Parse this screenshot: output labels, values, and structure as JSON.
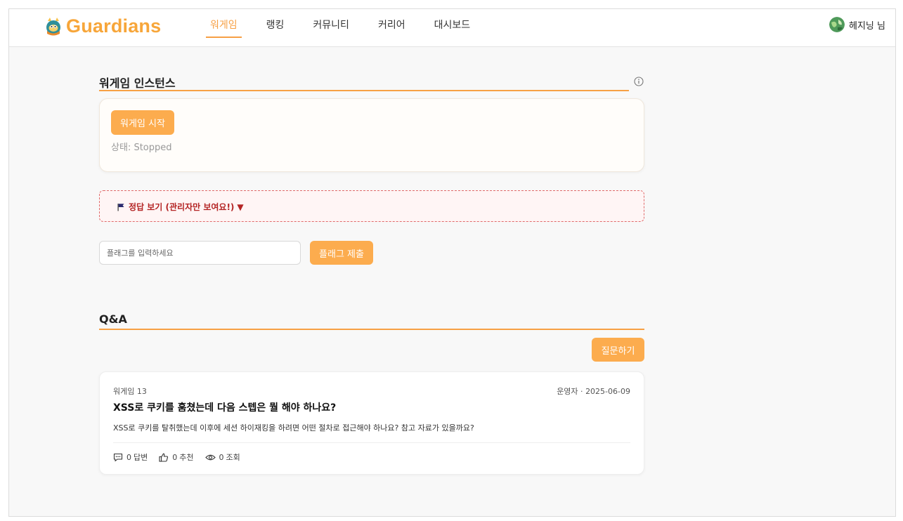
{
  "brand": {
    "name": "Guardians",
    "color": "#f7a63a"
  },
  "nav": {
    "items": [
      {
        "label": "워게임",
        "active": true
      },
      {
        "label": "랭킹",
        "active": false
      },
      {
        "label": "커뮤니티",
        "active": false
      },
      {
        "label": "커리어",
        "active": false
      },
      {
        "label": "대시보드",
        "active": false
      }
    ]
  },
  "user": {
    "name": "헤지닝 님",
    "avatar_icon": "avatar-globe-icon"
  },
  "instance": {
    "title": "워게임 인스턴스",
    "info_icon": "info-icon",
    "start_button": "워게임 시작",
    "status_label": "상태:",
    "status_value": "Stopped"
  },
  "answer": {
    "label": "정답 보기 (관리자만 보여요!)",
    "icon": "flag-icon",
    "toggle_icon": "triangle-down-icon"
  },
  "flag": {
    "placeholder": "플래그를 입력하세요",
    "submit_button": "플래그 제출"
  },
  "qa": {
    "title": "Q&A",
    "ask_button": "질문하기",
    "posts": [
      {
        "category": "워게임 13",
        "author": "운영자",
        "date": "2025-06-09",
        "title": "XSS로 쿠키를 훔쳤는데 다음 스텝은 뭘 해야 하나요?",
        "body": "XSS로 쿠키를 탈취했는데 이후에 세션 하이재킹을 하려면 어떤 절차로 접근해야 하나요? 참고 자료가 있을까요?",
        "answers_count": "0",
        "answers_label": "답변",
        "likes_count": "0",
        "likes_label": "추천",
        "views_count": "0",
        "views_label": "조회"
      }
    ]
  },
  "colors": {
    "accent": "#fcac4e",
    "rule": "#f7a044",
    "danger": "#b42525"
  }
}
